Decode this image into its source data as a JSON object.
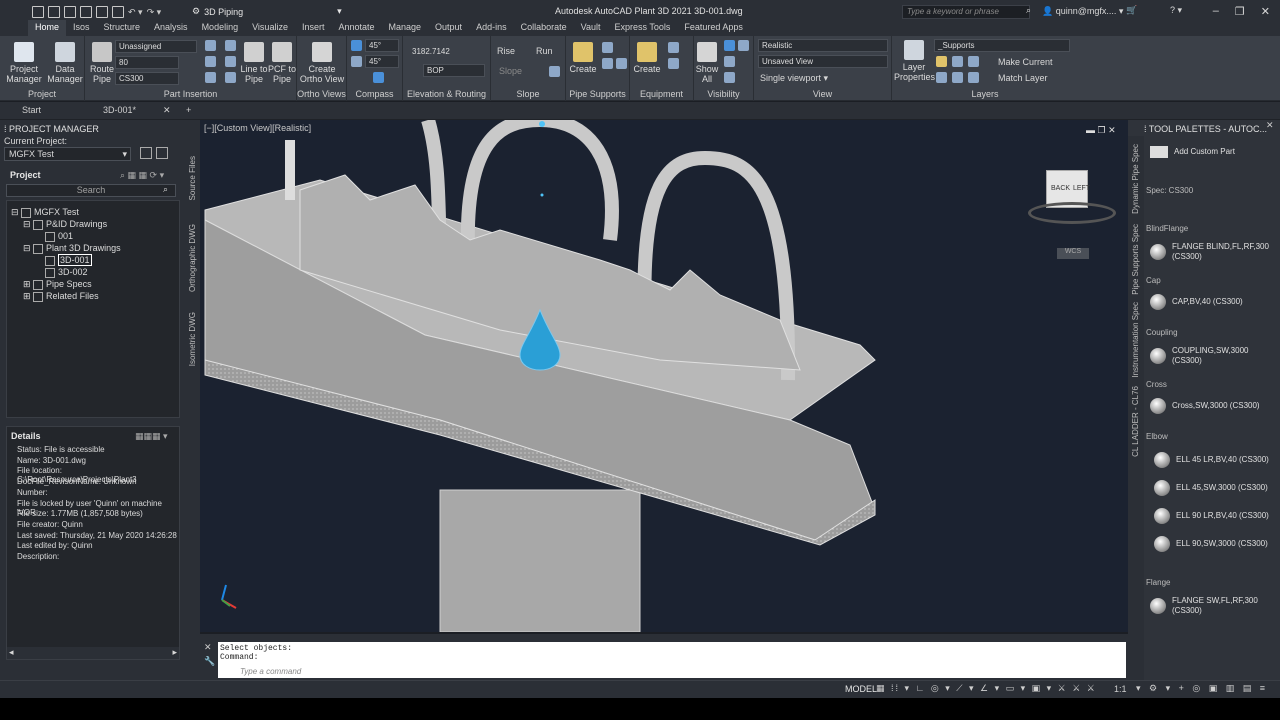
{
  "titlebar": {
    "workspace": "3D Piping",
    "title": "Autodesk AutoCAD Plant 3D 2021   3D-001.dwg",
    "search_placeholder": "Type a keyword or phrase",
    "user": "quinn@mgfx...."
  },
  "ribbon_tabs": [
    "Home",
    "Isos",
    "Structure",
    "Analysis",
    "Modeling",
    "Visualize",
    "Insert",
    "Annotate",
    "Manage",
    "Output",
    "Add-ins",
    "Collaborate",
    "Vault",
    "Express Tools",
    "Featured Apps"
  ],
  "ribbon": {
    "project_manager": "Project\nManager",
    "data_manager": "Data\nManager",
    "route_pipe": "Route\nPipe",
    "line_to_pipe": "Line to\nPipe",
    "pcf_to_pipe": "PCF to\nPipe",
    "create_ortho": "Create\nOrtho View",
    "combo_unassigned": "Unassigned",
    "combo_size": "80",
    "combo_spec": "CS300",
    "angle1": "45°",
    "angle2": "45°",
    "elev_value": "3182.7142",
    "bop": "BOP",
    "rise": "Rise",
    "run": "Run",
    "slope": "Slope",
    "create1": "Create",
    "create2": "Create",
    "show_all": "Show\nAll",
    "visual_style": "Realistic",
    "view": "Unsaved View",
    "viewport": "Single viewport",
    "layer_properties": "Layer\nProperties",
    "layer_combo": "_Supports",
    "make_current": "Make Current",
    "match_layer": "Match Layer",
    "panels": [
      "Project",
      "Part Insertion",
      "Ortho Views",
      "Compass",
      "Elevation & Routing",
      "Slope",
      "Pipe Supports",
      "Equipment",
      "Visibility",
      "View",
      "Layers"
    ]
  },
  "doc_tabs": {
    "start": "Start",
    "active": "3D-001*"
  },
  "project_manager": {
    "header": "PROJECT MANAGER",
    "current_project_label": "Current Project:",
    "current_project": "MGFX Test",
    "project_label": "Project",
    "search": "Search",
    "tree": [
      "MGFX Test",
      "P&ID Drawings",
      "001",
      "Plant 3D Drawings",
      "3D-001",
      "3D-002",
      "Pipe Specs",
      "Related Files"
    ],
    "side_tabs": [
      "Source Files",
      "Orthographic DWG",
      "Isometric DWG"
    ]
  },
  "details": {
    "header": "Details",
    "lines": [
      "Status: File is accessible",
      "Name: 3D-001.dwg",
      "File location: C:\\Root\\Resource\\Projects\\Plant3",
      "DocFile_RevisonName:  Unknown",
      "Number:",
      "File is locked by user 'Quinn' on machine 'VOR",
      "File size: 1.77MB (1,857,508 bytes)",
      "File creator: Quinn",
      "Last saved: Thursday, 21 May 2020 14:26:28",
      "Last edited by: Quinn",
      "Description:"
    ]
  },
  "viewport": {
    "label": "[−][Custom View][Realistic]",
    "wcs": "WCS",
    "cube_back": "BACK",
    "cube_left": "LEFT"
  },
  "command": {
    "line1": "Select objects:",
    "line2": "Command:",
    "placeholder": "Type a command"
  },
  "tool_palette": {
    "header": "TOOL PALETTES - AUTOC...",
    "add_custom": "Add Custom Part",
    "spec": "Spec: CS300",
    "side_tabs": [
      "Dynamic Pipe Spec",
      "Pipe Supports Spec",
      "Instrumentation Spec",
      "CL LADDER - CL76"
    ],
    "groups": [
      {
        "name": "BlindFlange",
        "items": [
          "FLANGE BLIND,FL,RF,300 (CS300)"
        ]
      },
      {
        "name": "Cap",
        "items": [
          "CAP,BV,40 (CS300)"
        ]
      },
      {
        "name": "Coupling",
        "items": [
          "COUPLING,SW,3000 (CS300)"
        ]
      },
      {
        "name": "Cross",
        "items": [
          "Cross,SW,3000 (CS300)"
        ]
      },
      {
        "name": "Elbow",
        "items": [
          "ELL 45 LR,BV,40 (CS300)",
          "ELL 45,SW,3000 (CS300)",
          "ELL 90 LR,BV,40 (CS300)",
          "ELL 90,SW,3000 (CS300)"
        ]
      },
      {
        "name": "Flange",
        "items": [
          "FLANGE SW,FL,RF,300 (CS300)"
        ]
      }
    ]
  },
  "statusbar": {
    "model": "MODEL",
    "scale": "1:1"
  }
}
